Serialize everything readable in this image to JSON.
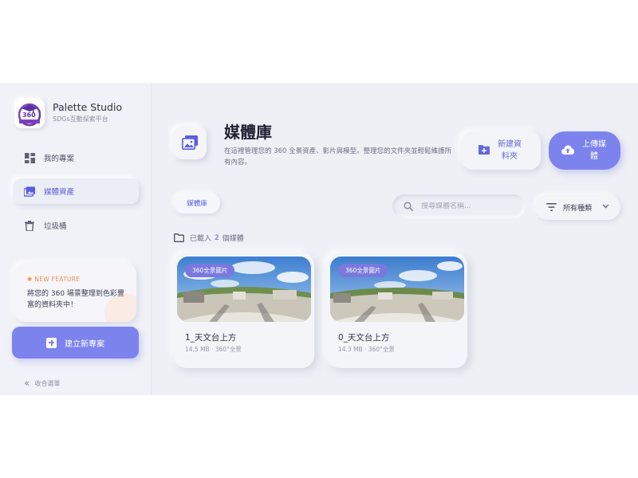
{
  "colors": {
    "accent": "#7c83ec",
    "accent_text": "#5b5de0",
    "feature_orange": "#f08b4e",
    "background": "#eff0f5"
  },
  "brand": {
    "name": "Palette Studio",
    "subtitle": "SDGs互動探索平台",
    "logo_text": "360"
  },
  "sidebar": {
    "items": [
      {
        "label": "我的專案",
        "icon": "grid-icon",
        "active": false
      },
      {
        "label": "媒體資產",
        "icon": "image-icon",
        "active": true
      },
      {
        "label": "垃圾桶",
        "icon": "trash-icon",
        "active": false
      }
    ],
    "feature": {
      "tag": "NEW FEATURE",
      "text": "將您的 360 場景整理到色彩豐富的資料夾中！"
    },
    "new_project_label": "建立新專案",
    "collapse_label": "收合選單"
  },
  "header": {
    "title": "媒體庫",
    "description": "在這裡管理您的 360 全景資產、影片與模型。整理您的文件夾並輕鬆維護所有內容。",
    "new_folder_label": "新建資料夾",
    "upload_label": "上傳媒體"
  },
  "toolbar": {
    "breadcrumb": "媒體庫",
    "search_placeholder": "搜尋媒體名稱...",
    "filter_label": "所有種類"
  },
  "summary": {
    "prefix": "已載入",
    "count": "2",
    "suffix": "個媒體"
  },
  "media": [
    {
      "badge": "360全景圖片",
      "name": "1_天文台上方",
      "meta": "14.5 MB · 360°全景"
    },
    {
      "badge": "360全景圖片",
      "name": "0_天文台上方",
      "meta": "14.3 MB · 360°全景"
    }
  ]
}
